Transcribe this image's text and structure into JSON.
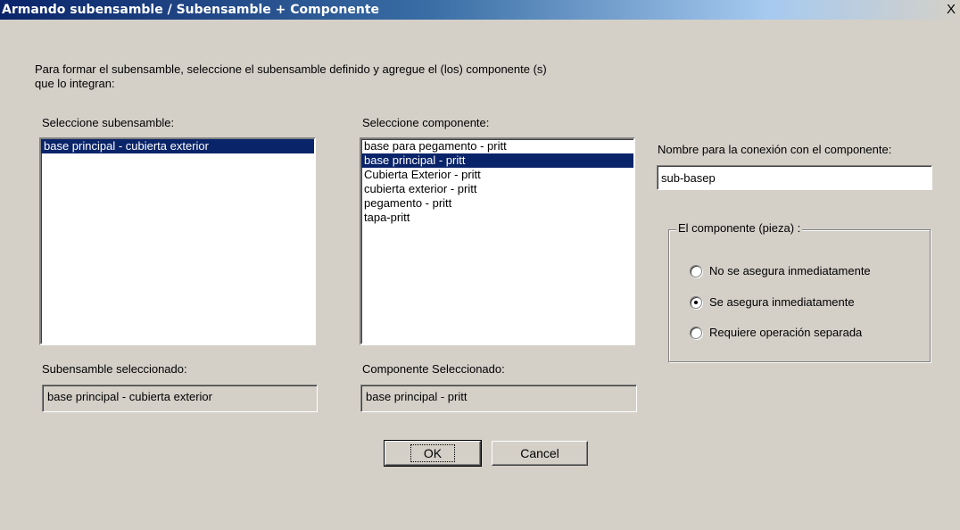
{
  "window": {
    "title": "Armando subensamble / Subensamble + Componente",
    "close_glyph": "X"
  },
  "instructions": {
    "line1": "Para formar el subensamble, seleccione el subensamble definido y agregue el (los) componente (s)",
    "line2": "que lo integran:"
  },
  "subassembly": {
    "label": "Seleccione subensamble:",
    "items": [
      "base principal - cubierta exterior"
    ],
    "selected_index": 0,
    "selected_label": "Subensamble seleccionado:",
    "selected_value": "base principal - cubierta exterior"
  },
  "component": {
    "label": "Seleccione componente:",
    "items": [
      "base para pegamento - pritt",
      "base principal - pritt",
      "Cubierta Exterior - pritt",
      "cubierta exterior - pritt",
      "pegamento - pritt",
      "tapa-pritt"
    ],
    "selected_index": 1,
    "selected_label": "Componente Seleccionado:",
    "selected_value": "base principal - pritt"
  },
  "connection": {
    "label": "Nombre para la conexión con el componente:",
    "value": "sub-basep"
  },
  "piece_group": {
    "legend": "El componente (pieza) :",
    "options": [
      {
        "label": "No se asegura inmediatamente",
        "checked": false
      },
      {
        "label": "Se asegura inmediatamente",
        "checked": true
      },
      {
        "label": "Requiere operación separada",
        "checked": false
      }
    ]
  },
  "buttons": {
    "ok": "OK",
    "cancel": "Cancel"
  },
  "colors": {
    "title_bar": "#0a246a",
    "selection": "#0a246a",
    "dialog_face": "#d4d0c8"
  }
}
